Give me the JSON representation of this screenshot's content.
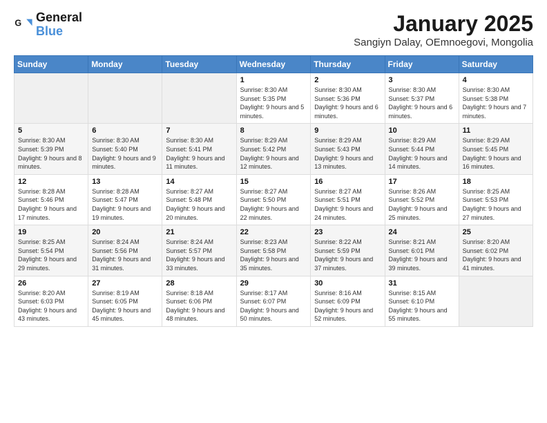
{
  "header": {
    "logo_line1": "General",
    "logo_line2": "Blue",
    "title": "January 2025",
    "subtitle": "Sangiyn Dalay, OEmnoegovi, Mongolia"
  },
  "weekdays": [
    "Sunday",
    "Monday",
    "Tuesday",
    "Wednesday",
    "Thursday",
    "Friday",
    "Saturday"
  ],
  "weeks": [
    [
      {
        "day": "",
        "detail": ""
      },
      {
        "day": "",
        "detail": ""
      },
      {
        "day": "",
        "detail": ""
      },
      {
        "day": "1",
        "detail": "Sunrise: 8:30 AM\nSunset: 5:35 PM\nDaylight: 9 hours and 5 minutes."
      },
      {
        "day": "2",
        "detail": "Sunrise: 8:30 AM\nSunset: 5:36 PM\nDaylight: 9 hours and 6 minutes."
      },
      {
        "day": "3",
        "detail": "Sunrise: 8:30 AM\nSunset: 5:37 PM\nDaylight: 9 hours and 6 minutes."
      },
      {
        "day": "4",
        "detail": "Sunrise: 8:30 AM\nSunset: 5:38 PM\nDaylight: 9 hours and 7 minutes."
      }
    ],
    [
      {
        "day": "5",
        "detail": "Sunrise: 8:30 AM\nSunset: 5:39 PM\nDaylight: 9 hours and 8 minutes."
      },
      {
        "day": "6",
        "detail": "Sunrise: 8:30 AM\nSunset: 5:40 PM\nDaylight: 9 hours and 9 minutes."
      },
      {
        "day": "7",
        "detail": "Sunrise: 8:30 AM\nSunset: 5:41 PM\nDaylight: 9 hours and 11 minutes."
      },
      {
        "day": "8",
        "detail": "Sunrise: 8:29 AM\nSunset: 5:42 PM\nDaylight: 9 hours and 12 minutes."
      },
      {
        "day": "9",
        "detail": "Sunrise: 8:29 AM\nSunset: 5:43 PM\nDaylight: 9 hours and 13 minutes."
      },
      {
        "day": "10",
        "detail": "Sunrise: 8:29 AM\nSunset: 5:44 PM\nDaylight: 9 hours and 14 minutes."
      },
      {
        "day": "11",
        "detail": "Sunrise: 8:29 AM\nSunset: 5:45 PM\nDaylight: 9 hours and 16 minutes."
      }
    ],
    [
      {
        "day": "12",
        "detail": "Sunrise: 8:28 AM\nSunset: 5:46 PM\nDaylight: 9 hours and 17 minutes."
      },
      {
        "day": "13",
        "detail": "Sunrise: 8:28 AM\nSunset: 5:47 PM\nDaylight: 9 hours and 19 minutes."
      },
      {
        "day": "14",
        "detail": "Sunrise: 8:27 AM\nSunset: 5:48 PM\nDaylight: 9 hours and 20 minutes."
      },
      {
        "day": "15",
        "detail": "Sunrise: 8:27 AM\nSunset: 5:50 PM\nDaylight: 9 hours and 22 minutes."
      },
      {
        "day": "16",
        "detail": "Sunrise: 8:27 AM\nSunset: 5:51 PM\nDaylight: 9 hours and 24 minutes."
      },
      {
        "day": "17",
        "detail": "Sunrise: 8:26 AM\nSunset: 5:52 PM\nDaylight: 9 hours and 25 minutes."
      },
      {
        "day": "18",
        "detail": "Sunrise: 8:25 AM\nSunset: 5:53 PM\nDaylight: 9 hours and 27 minutes."
      }
    ],
    [
      {
        "day": "19",
        "detail": "Sunrise: 8:25 AM\nSunset: 5:54 PM\nDaylight: 9 hours and 29 minutes."
      },
      {
        "day": "20",
        "detail": "Sunrise: 8:24 AM\nSunset: 5:56 PM\nDaylight: 9 hours and 31 minutes."
      },
      {
        "day": "21",
        "detail": "Sunrise: 8:24 AM\nSunset: 5:57 PM\nDaylight: 9 hours and 33 minutes."
      },
      {
        "day": "22",
        "detail": "Sunrise: 8:23 AM\nSunset: 5:58 PM\nDaylight: 9 hours and 35 minutes."
      },
      {
        "day": "23",
        "detail": "Sunrise: 8:22 AM\nSunset: 5:59 PM\nDaylight: 9 hours and 37 minutes."
      },
      {
        "day": "24",
        "detail": "Sunrise: 8:21 AM\nSunset: 6:01 PM\nDaylight: 9 hours and 39 minutes."
      },
      {
        "day": "25",
        "detail": "Sunrise: 8:20 AM\nSunset: 6:02 PM\nDaylight: 9 hours and 41 minutes."
      }
    ],
    [
      {
        "day": "26",
        "detail": "Sunrise: 8:20 AM\nSunset: 6:03 PM\nDaylight: 9 hours and 43 minutes."
      },
      {
        "day": "27",
        "detail": "Sunrise: 8:19 AM\nSunset: 6:05 PM\nDaylight: 9 hours and 45 minutes."
      },
      {
        "day": "28",
        "detail": "Sunrise: 8:18 AM\nSunset: 6:06 PM\nDaylight: 9 hours and 48 minutes."
      },
      {
        "day": "29",
        "detail": "Sunrise: 8:17 AM\nSunset: 6:07 PM\nDaylight: 9 hours and 50 minutes."
      },
      {
        "day": "30",
        "detail": "Sunrise: 8:16 AM\nSunset: 6:09 PM\nDaylight: 9 hours and 52 minutes."
      },
      {
        "day": "31",
        "detail": "Sunrise: 8:15 AM\nSunset: 6:10 PM\nDaylight: 9 hours and 55 minutes."
      },
      {
        "day": "",
        "detail": ""
      }
    ]
  ]
}
